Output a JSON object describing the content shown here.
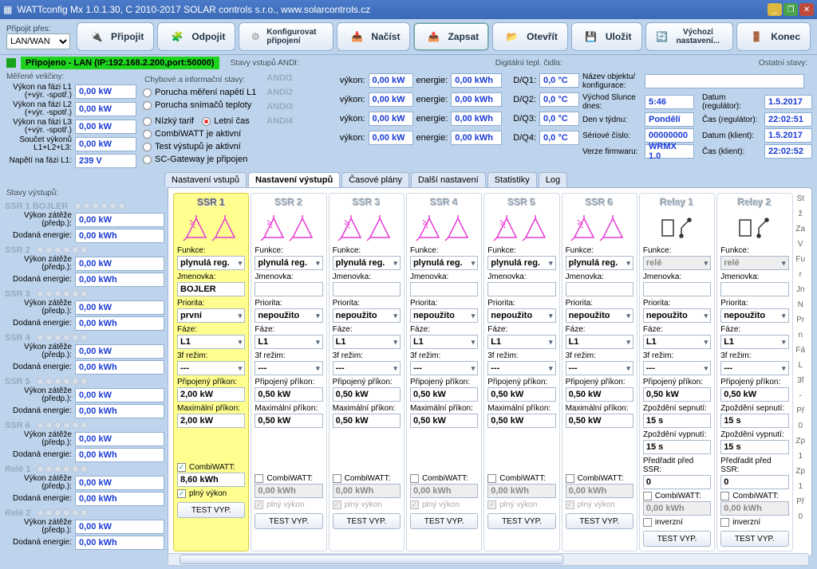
{
  "title": "WATTconfig Mx 1.0.1.30, C 2010-2017 SOLAR controls s.r.o., www.solarcontrols.cz",
  "conn": {
    "label": "Připojit přes:",
    "mode": "LAN/WAN"
  },
  "toolbar": {
    "pripojit": "Připojit",
    "odpojit": "Odpojit",
    "konfig": "Konfigurovat připojení",
    "nacist": "Načíst",
    "zapsat": "Zapsat",
    "otevrit": "Otevřít",
    "ulozit": "Uložit",
    "vychozi": "Výchozí nastavení...",
    "konec": "Konec"
  },
  "status": "Připojeno - LAN (IP:192.168.2.200,port:50000)",
  "sections": {
    "merene": "Měřené veličiny:",
    "chyby": "Chybové a informační stavy:",
    "andi": "Stavy vstupů ANDI:",
    "digi": "Digitální tepl. čidla:",
    "ostatni": "Ostatní stavy:",
    "stavy": "Stavy výstupů:"
  },
  "meas": {
    "l1": {
      "label": "Výkon na fázi L1 (+výr. -spotř.)",
      "val": "0,00 kW"
    },
    "l2": {
      "label": "Výkon na fázi L2 (+výr. -spotř.)",
      "val": "0,00 kW"
    },
    "l3": {
      "label": "Výkon na fázi L3 (+výr. -spotř.)",
      "val": "0,00 kW"
    },
    "sum": {
      "label": "Součet výkonů L1+L2+L3:",
      "val": "0,00 kW"
    },
    "volt": {
      "label": "Napětí na fázi L1:",
      "val": "239 V"
    }
  },
  "err": {
    "mnapeti": "Porucha měření napětí L1",
    "snimace": "Porucha snímačů teploty",
    "ntarif": "Nízký tarif",
    "letni": "Letní čas",
    "cwatt": "CombiWATT je aktivní",
    "test": "Test výstupů je aktivní",
    "scgw": "SC-Gateway je připojen"
  },
  "andi_vals": {
    "vykon_l": "výkon:",
    "vykon": "0,00 kW",
    "energie_l": "energie:",
    "energie": "0,00 kWh",
    "dq_l": [
      "D/Q1:",
      "D/Q2:",
      "D/Q3:",
      "D/Q4:"
    ],
    "dq": "0,0 °C"
  },
  "andi_names": [
    "ANDI1",
    "ANDI2",
    "ANDI3",
    "ANDI4"
  ],
  "meta": {
    "nazev_l": "Název objektu/ konfigurace:",
    "nazev": "",
    "vychod_l": "Východ Slunce dnes:",
    "vychod": "5:46",
    "den_l": "Den v týdnu:",
    "den": "Pondělí",
    "sn_l": "Sériové číslo:",
    "sn": "00000000",
    "fw_l": "Verze firmwaru:",
    "fw": "WRMX  1.0",
    "datumr_l": "Datum (regulátor):",
    "datumr": "1.5.2017",
    "casr_l": "Čas (regulátor):",
    "casr": "22:02:51",
    "datumk_l": "Datum (klient):",
    "datumk": "1.5.2017",
    "cask_l": "Čas (klient):",
    "cask": "22:02:52"
  },
  "tabs": [
    "Nastavení vstupů",
    "Nastavení výstupů",
    "Časové plány",
    "Další nastavení",
    "Statistiky",
    "Log"
  ],
  "stavy_items": [
    "SSR 1 BOJLER",
    "SSR 2",
    "SSR 3",
    "SSR 4",
    "SSR 5",
    "SSR 6",
    "Relé 1",
    "Relé 2"
  ],
  "stavy_labels": {
    "vz": "Výkon zátěže (předp.):",
    "de": "Dodaná energie:",
    "vz_v": "0,00 kW",
    "de_v": "0,00 kWh"
  },
  "outlabels": {
    "funkce": "Funkce:",
    "jmen": "Jmenovka:",
    "prio": "Priorita:",
    "faze": "Fáze:",
    "rezim": "3f režim:",
    "prip": "Připojený příkon:",
    "max": "Maximální příkon:",
    "zpse": "Zpoždění sepnutí:",
    "zpvy": "Zpoždění vypnutí:",
    "pred": "Předřadit před SSR:",
    "cw": "CombiWATT:",
    "pv": "plný výkon",
    "inv": "inverzní",
    "test": "TEST VYP."
  },
  "outs": [
    {
      "name": "SSR 1",
      "type": "ssr",
      "sel": true,
      "funkce": "plynulá reg.",
      "jmen": "BOJLER",
      "prio": "první",
      "faze": "L1",
      "rezim": "---",
      "prip": "2,00 kW",
      "max": "2,00 kW",
      "cw_on": true,
      "cw_val": "8,60 kWh",
      "pv_on": true
    },
    {
      "name": "SSR 2",
      "type": "ssr",
      "sel": false,
      "funkce": "plynulá reg.",
      "jmen": "",
      "prio": "nepoužito",
      "faze": "L1",
      "rezim": "---",
      "prip": "0,50 kW",
      "max": "0,50 kW",
      "cw_on": false,
      "cw_val": "0,00 kWh",
      "pv_on": false
    },
    {
      "name": "SSR 3",
      "type": "ssr",
      "sel": false,
      "funkce": "plynulá reg.",
      "jmen": "",
      "prio": "nepoužito",
      "faze": "L1",
      "rezim": "---",
      "prip": "0,50 kW",
      "max": "0,50 kW",
      "cw_on": false,
      "cw_val": "0,00 kWh",
      "pv_on": false
    },
    {
      "name": "SSR 4",
      "type": "ssr",
      "sel": false,
      "funkce": "plynulá reg.",
      "jmen": "",
      "prio": "nepoužito",
      "faze": "L1",
      "rezim": "---",
      "prip": "0,50 kW",
      "max": "0,50 kW",
      "cw_on": false,
      "cw_val": "0,00 kWh",
      "pv_on": false
    },
    {
      "name": "SSR 5",
      "type": "ssr",
      "sel": false,
      "funkce": "plynulá reg.",
      "jmen": "",
      "prio": "nepoužito",
      "faze": "L1",
      "rezim": "---",
      "prip": "0,50 kW",
      "max": "0,50 kW",
      "cw_on": false,
      "cw_val": "0,00 kWh",
      "pv_on": false
    },
    {
      "name": "SSR 6",
      "type": "ssr",
      "sel": false,
      "funkce": "plynulá reg.",
      "jmen": "",
      "prio": "nepoužito",
      "faze": "L1",
      "rezim": "---",
      "prip": "0,50 kW",
      "max": "0,50 kW",
      "cw_on": false,
      "cw_val": "0,00 kWh",
      "pv_on": false
    },
    {
      "name": "Relay 1",
      "type": "relay",
      "sel": false,
      "funkce": "relé",
      "jmen": "",
      "prio": "nepoužito",
      "faze": "L1",
      "rezim": "---",
      "prip": "0,50 kW",
      "zpse": "15 s",
      "zpvy": "15 s",
      "pred": "0",
      "cw_on": false,
      "cw_val": "0,00 kWh",
      "inv": false
    },
    {
      "name": "Relay 2",
      "type": "relay",
      "sel": false,
      "funkce": "relé",
      "jmen": "",
      "prio": "nepoužito",
      "faze": "L1",
      "rezim": "---",
      "prip": "0,50 kW",
      "zpse": "15 s",
      "zpvy": "15 s",
      "pred": "0",
      "cw_on": false,
      "cw_val": "0,00 kWh",
      "inv": false
    }
  ],
  "strip": [
    "St",
    "ž",
    "Za",
    "V",
    "Fu",
    "r",
    "Jn",
    "N",
    "Pr",
    "n",
    "Fá",
    "L",
    "3f",
    "-",
    "Př",
    "0",
    "Zp",
    "1",
    "Zp",
    "1",
    "Př",
    "0"
  ]
}
